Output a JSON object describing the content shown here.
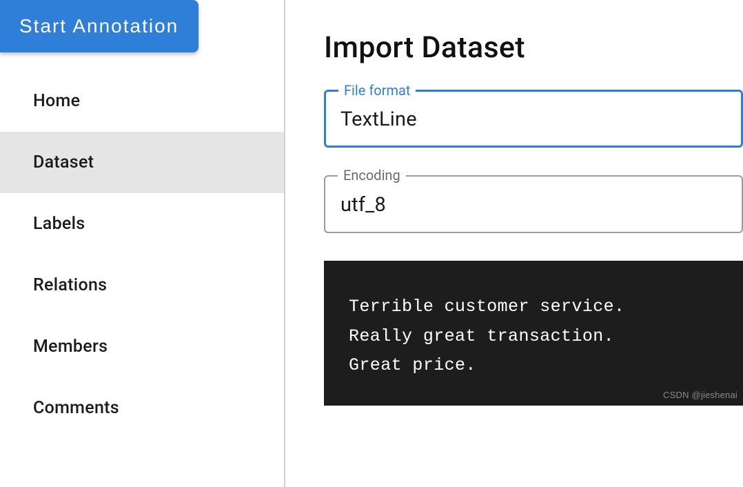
{
  "sidebar": {
    "start_button_label": "Start Annotation",
    "nav": {
      "home": "Home",
      "dataset": "Dataset",
      "labels": "Labels",
      "relations": "Relations",
      "members": "Members",
      "comments": "Comments"
    }
  },
  "main": {
    "title": "Import Dataset",
    "file_format": {
      "label": "File format",
      "value": "TextLine"
    },
    "encoding": {
      "label": "Encoding",
      "value": "utf_8"
    },
    "sample_text": "Terrible customer service.\nReally great transaction.\nGreat price."
  },
  "watermark": "CSDN @jieshenai"
}
